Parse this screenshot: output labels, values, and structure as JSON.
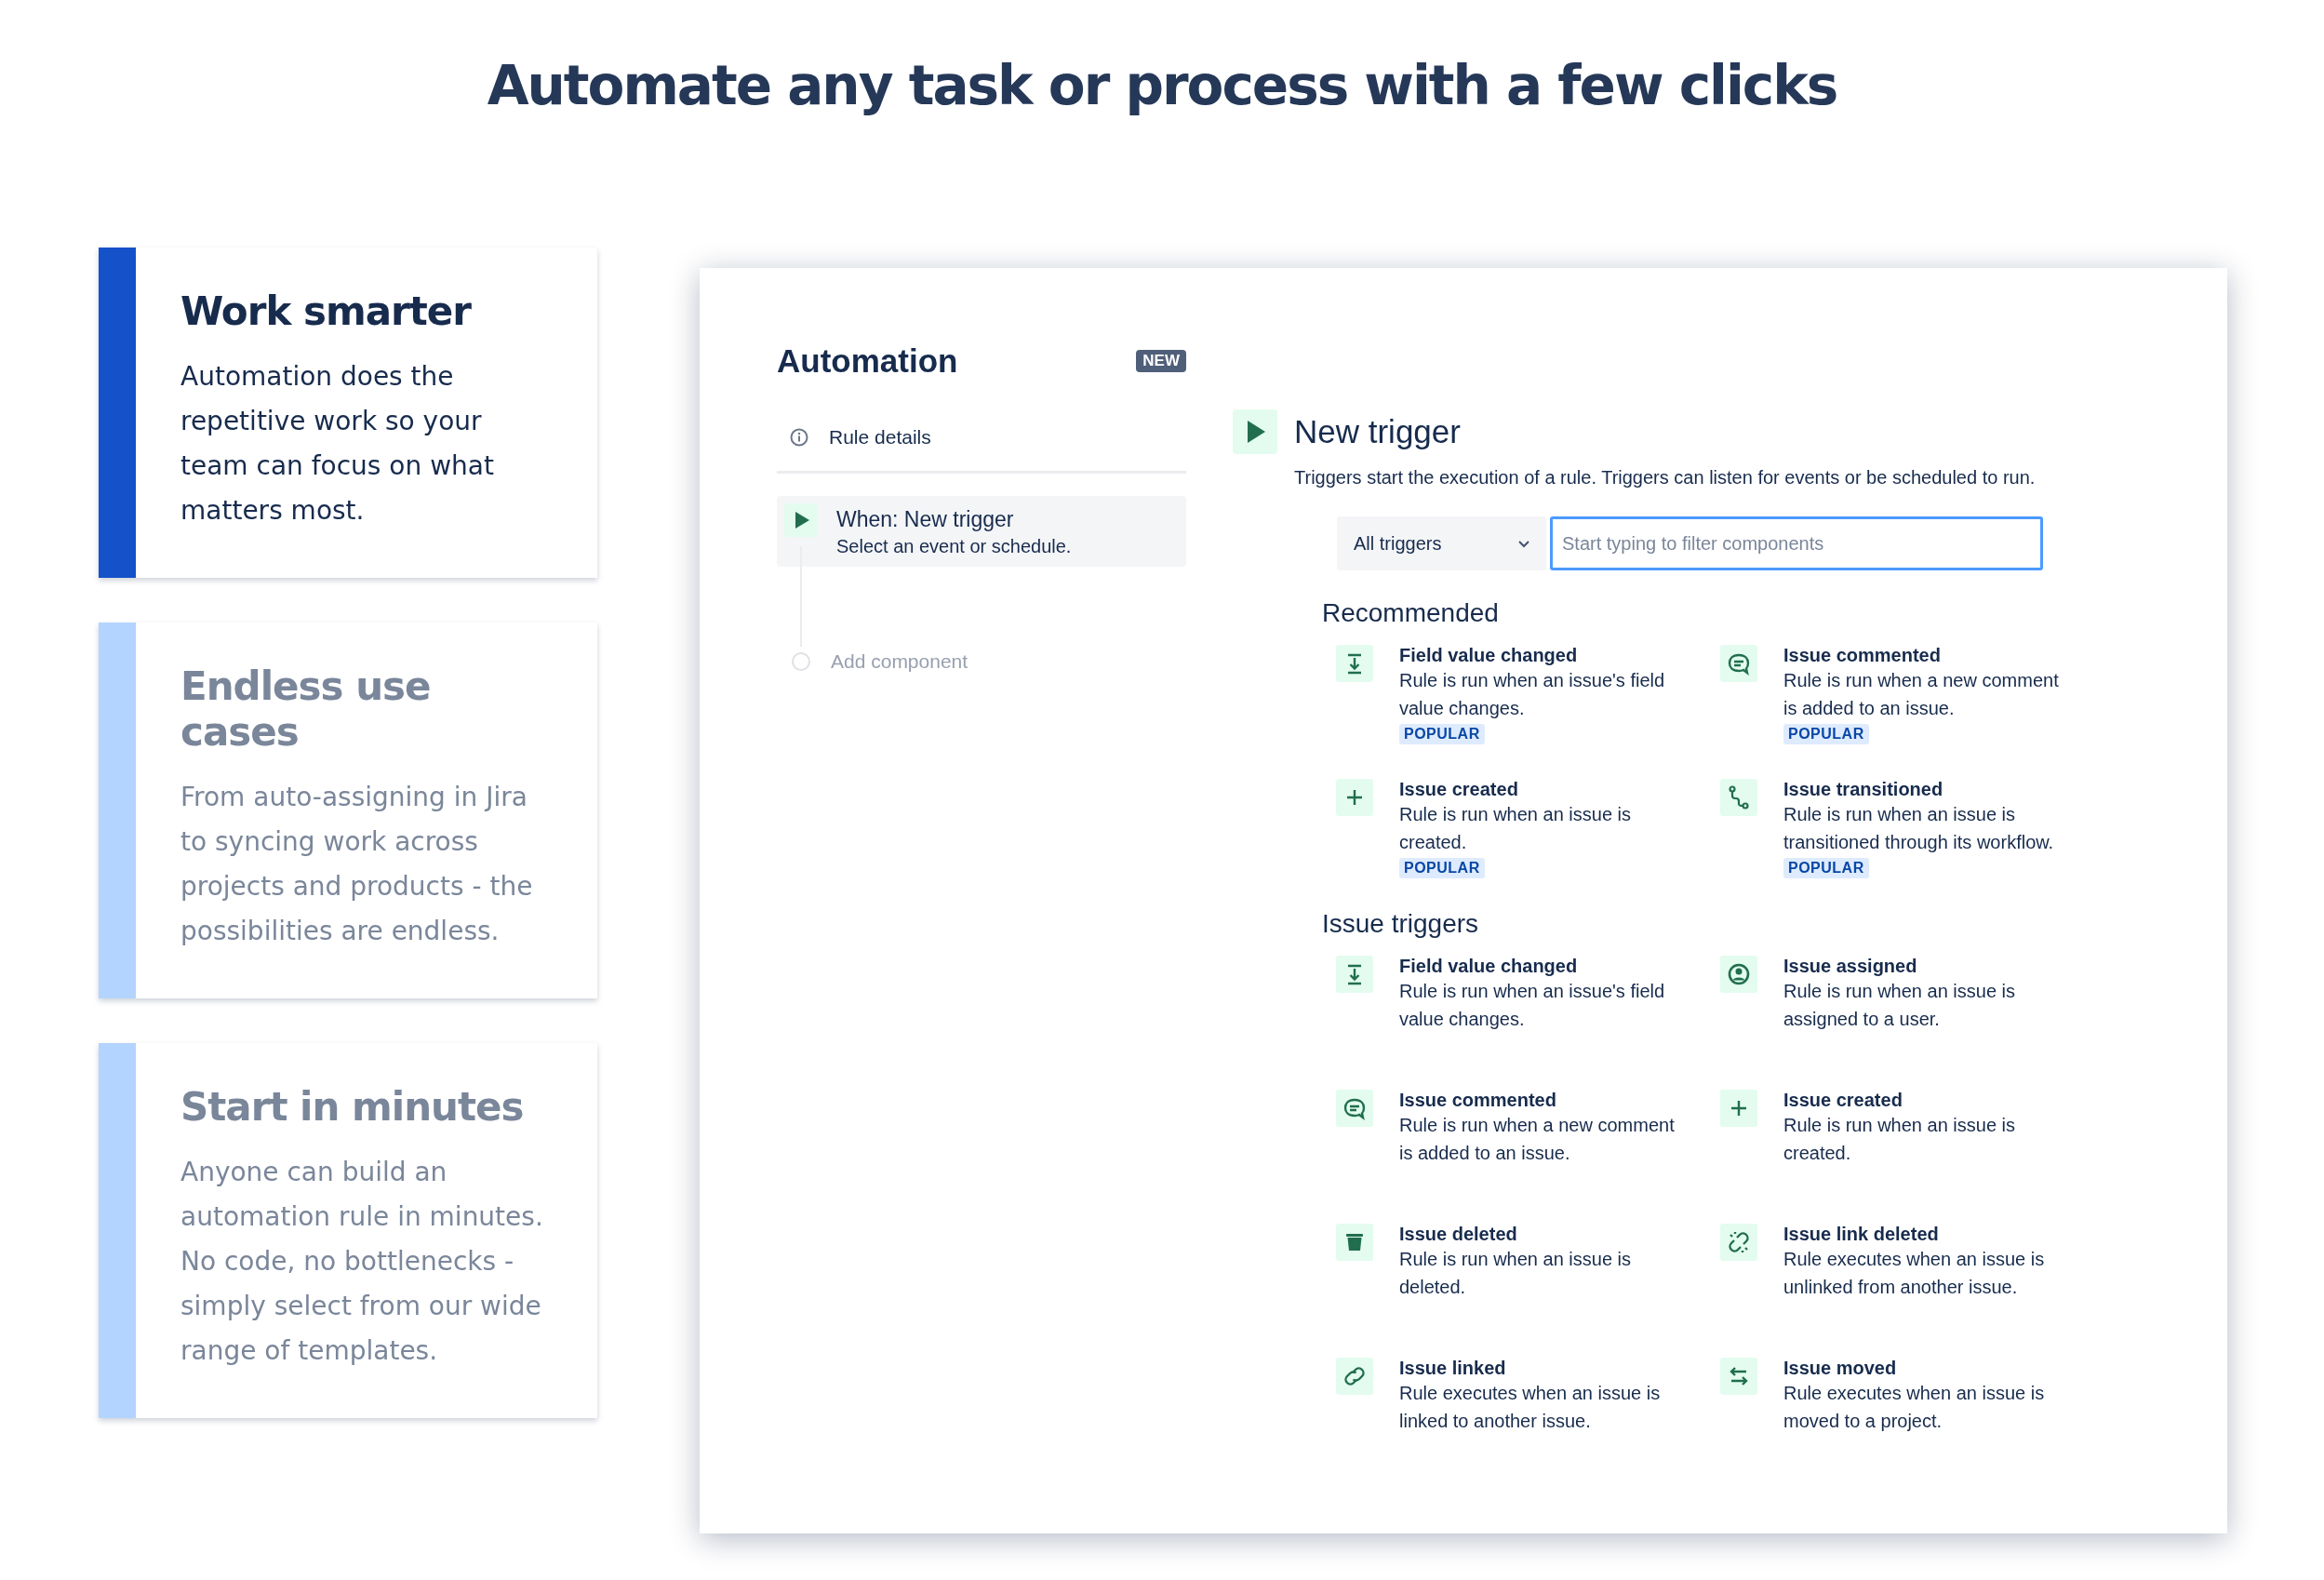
{
  "headline": "Automate any task or process with a few clicks",
  "feature_cards": [
    {
      "title": "Work smarter",
      "body": "Automation does the repetitive work so your team can focus on what matters most.",
      "selected": true
    },
    {
      "title": "Endless use cases",
      "body": "From auto-assigning in Jira to syncing work across projects and products - the possibilities are endless.",
      "selected": false
    },
    {
      "title": "Start in minutes",
      "body": "Anyone can build an automation rule in minutes. No code, no bottlenecks - simply select from our wide range of templates.",
      "selected": false
    }
  ],
  "automation": {
    "title": "Automation",
    "badge": "NEW",
    "rule_details": "Rule details",
    "trigger_step": {
      "title": "When: New trigger",
      "subtitle": "Select an event or schedule."
    },
    "add_component": "Add component"
  },
  "trigger_panel": {
    "title": "New trigger",
    "description": "Triggers start the execution of a rule. Triggers can listen for events or be scheduled to run.",
    "filter_select": "All triggers",
    "filter_placeholder": "Start typing to filter components",
    "sections": [
      {
        "heading": "Recommended",
        "items": [
          {
            "kind": "field",
            "title": "Field value changed",
            "description": "Rule is run when an issue's field value changes.",
            "badge": "POPULAR"
          },
          {
            "kind": "comment",
            "title": "Issue commented",
            "description": "Rule is run when a new comment is added to an issue.",
            "badge": "POPULAR"
          },
          {
            "kind": "create",
            "title": "Issue created",
            "description": "Rule is run when an issue is created.",
            "badge": "POPULAR"
          },
          {
            "kind": "transition",
            "title": "Issue transitioned",
            "description": "Rule is run when an issue is transitioned through its workflow.",
            "badge": "POPULAR"
          }
        ]
      },
      {
        "heading": "Issue triggers",
        "items": [
          {
            "kind": "field",
            "title": "Field value changed",
            "description": "Rule is run when an issue's field value changes."
          },
          {
            "kind": "assign",
            "title": "Issue assigned",
            "description": "Rule is run when an issue is assigned to a user."
          },
          {
            "kind": "comment",
            "title": "Issue commented",
            "description": "Rule is run when a new comment is added to an issue."
          },
          {
            "kind": "create",
            "title": "Issue created",
            "description": "Rule is run when an issue is created."
          },
          {
            "kind": "delete",
            "title": "Issue deleted",
            "description": "Rule is run when an issue is deleted."
          },
          {
            "kind": "unlink",
            "title": "Issue link deleted",
            "description": "Rule executes when an issue is unlinked from another issue."
          },
          {
            "kind": "link",
            "title": "Issue linked",
            "description": "Rule executes when an issue is linked to another issue."
          },
          {
            "kind": "move",
            "title": "Issue moved",
            "description": "Rule executes when an issue is moved to a project."
          }
        ]
      }
    ]
  }
}
